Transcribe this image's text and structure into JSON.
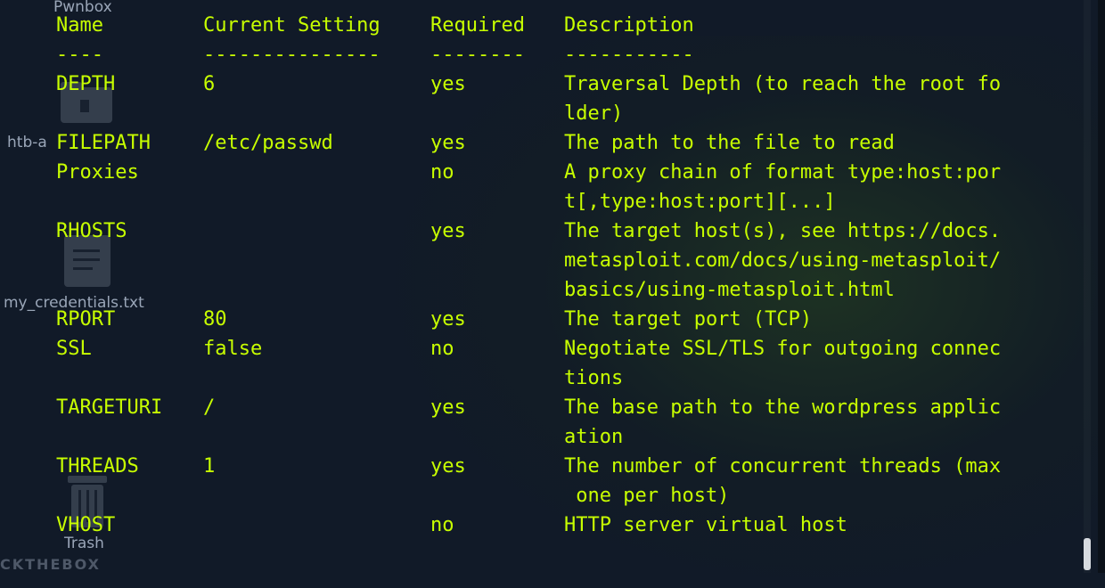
{
  "desktop": {
    "icons": [
      {
        "name": "Pwnbox",
        "icon": "folder-icon"
      },
      {
        "name": "htb-a",
        "icon": "file-icon"
      },
      {
        "name": "my_credentials.txt",
        "icon": "text-file-icon"
      },
      {
        "name": "Trash",
        "icon": "trash-icon"
      }
    ],
    "brand": "CKTHEBOX"
  },
  "table": {
    "headers": [
      "Name",
      "Current Setting",
      "Required",
      "Description"
    ],
    "separators": [
      "----",
      "---------------",
      "--------",
      "-----------"
    ],
    "rows": [
      {
        "name": "DEPTH",
        "setting": "6",
        "required": "yes",
        "description": [
          "Traversal Depth (to reach the root fo",
          "lder)"
        ]
      },
      {
        "name": "FILEPATH",
        "setting": "/etc/passwd",
        "required": "yes",
        "description": [
          "The path to the file to read"
        ]
      },
      {
        "name": "Proxies",
        "setting": "",
        "required": "no",
        "description": [
          "A proxy chain of format type:host:por",
          "t[,type:host:port][...]"
        ]
      },
      {
        "name": "RHOSTS",
        "setting": "",
        "required": "yes",
        "description": [
          "The target host(s), see https://docs.",
          "metasploit.com/docs/using-metasploit/",
          "basics/using-metasploit.html"
        ]
      },
      {
        "name": "RPORT",
        "setting": "80",
        "required": "yes",
        "description": [
          "The target port (TCP)"
        ]
      },
      {
        "name": "SSL",
        "setting": "false",
        "required": "no",
        "description": [
          "Negotiate SSL/TLS for outgoing connec",
          "tions"
        ]
      },
      {
        "name": "TARGETURI",
        "setting": "/",
        "required": "yes",
        "description": [
          "The base path to the wordpress applic",
          "ation"
        ]
      },
      {
        "name": "THREADS",
        "setting": "1",
        "required": "yes",
        "description": [
          "The number of concurrent threads (max",
          " one per host)"
        ]
      },
      {
        "name": "VHOST",
        "setting": "",
        "required": "no",
        "description": [
          "HTTP server virtual host"
        ]
      }
    ]
  },
  "colors": {
    "terminal_text": "#c8ff00",
    "background": "#111a28"
  }
}
